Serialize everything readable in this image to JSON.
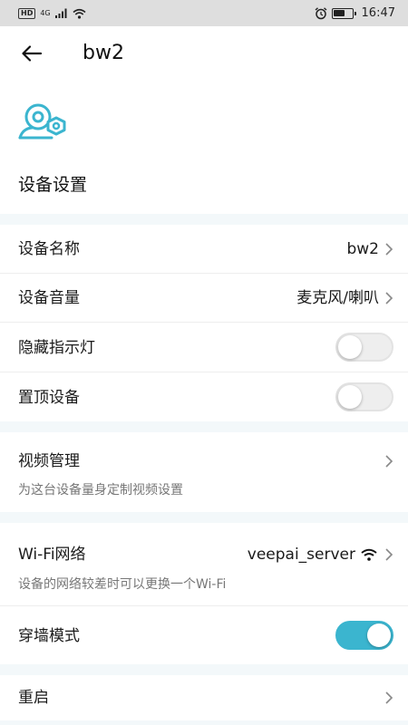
{
  "status_bar": {
    "hd": "HD",
    "network": "4G",
    "time": "16:47"
  },
  "header": {
    "title": "bw2"
  },
  "section_title": "设备设置",
  "settings": {
    "device_name": {
      "label": "设备名称",
      "value": "bw2"
    },
    "device_volume": {
      "label": "设备音量",
      "value": "麦克风/喇叭"
    },
    "hide_indicator": {
      "label": "隐藏指示灯",
      "enabled": false
    },
    "pin_device": {
      "label": "置顶设备",
      "enabled": false
    },
    "video_management": {
      "label": "视频管理",
      "subtitle": "为这台设备量身定制视频设置"
    },
    "wifi": {
      "label": "Wi-Fi网络",
      "value": "veepai_server",
      "subtitle": "设备的网络较差时可以更换一个Wi-Fi"
    },
    "wall_mode": {
      "label": "穿墙模式",
      "enabled": true
    },
    "reboot": {
      "label": "重启"
    }
  },
  "colors": {
    "accent": "#3bb5cf",
    "section_gap": "#f3f8fa",
    "status_bar": "#dedede"
  }
}
